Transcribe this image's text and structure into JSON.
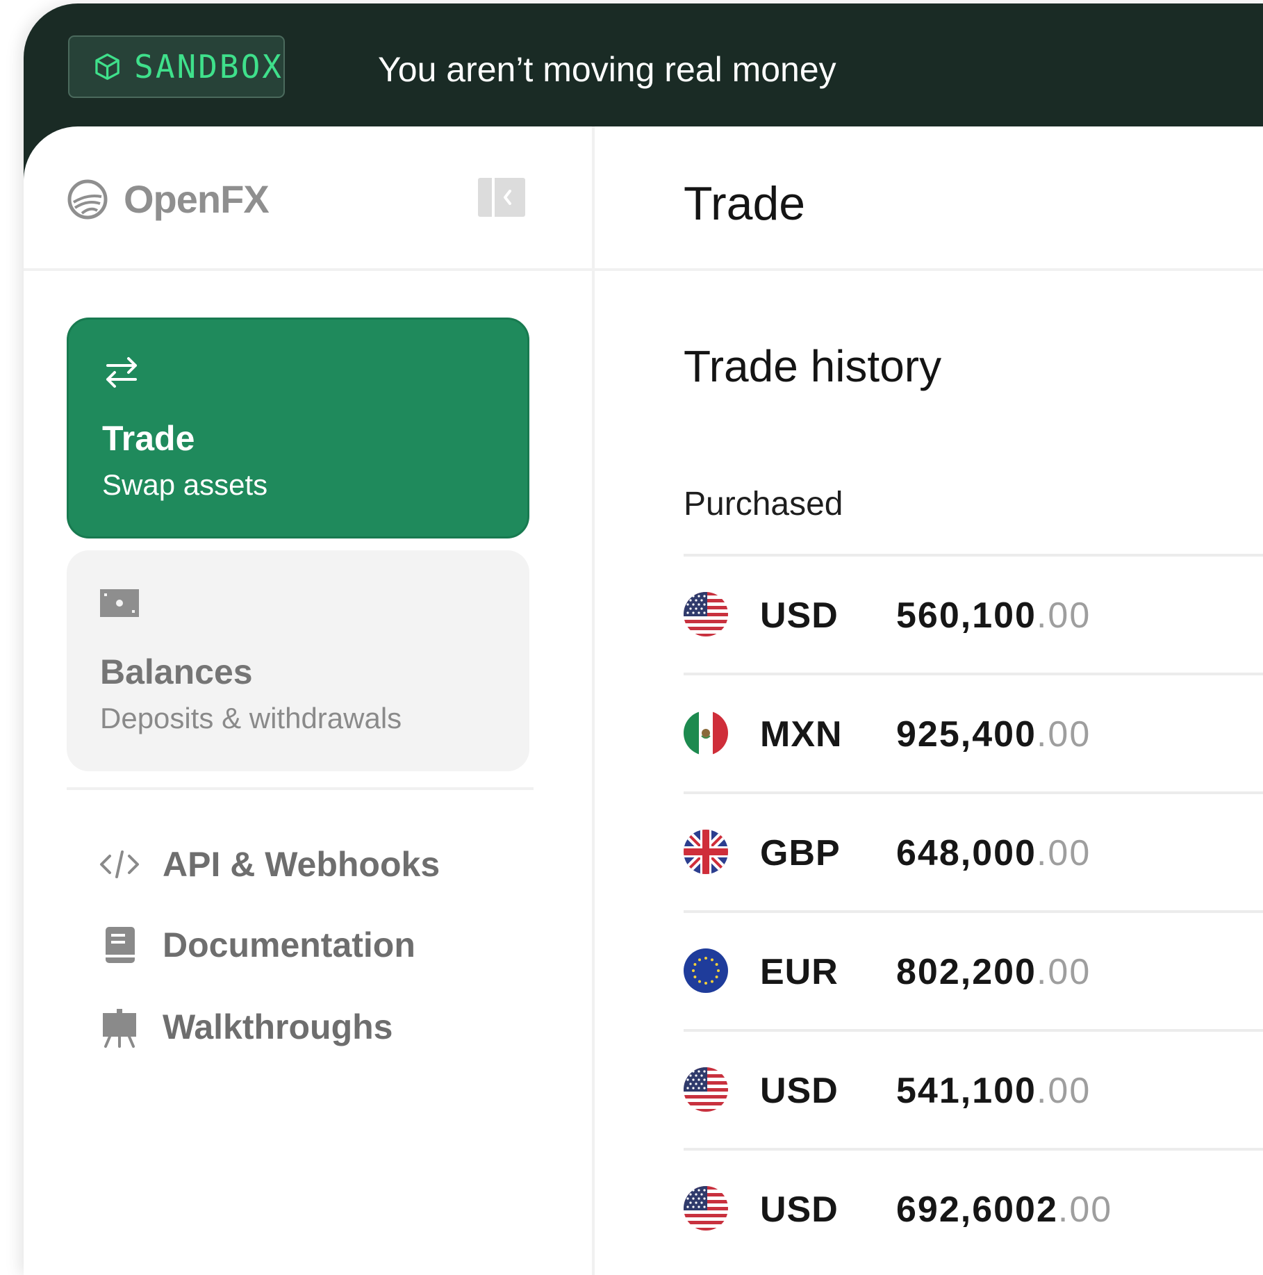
{
  "banner": {
    "badge_label": "SANDBOX",
    "note": "You aren’t moving real money"
  },
  "brand": {
    "name": "OpenFX"
  },
  "header": {
    "title": "Trade"
  },
  "sidebar": {
    "cards": [
      {
        "icon": "swap-arrows-icon",
        "title": "Trade",
        "subtitle": "Swap assets",
        "active": true
      },
      {
        "icon": "wallet-icon",
        "title": "Balances",
        "subtitle": "Deposits & withdrawals",
        "active": false
      }
    ],
    "links": [
      {
        "icon": "code-icon",
        "label": "API & Webhooks"
      },
      {
        "icon": "book-icon",
        "label": "Documentation"
      },
      {
        "icon": "easel-icon",
        "label": "Walkthroughs"
      }
    ]
  },
  "main": {
    "section_title": "Trade history",
    "column_header": "Purchased",
    "rows": [
      {
        "currency": "USD",
        "flag": "us-flag",
        "amount_whole": "560,100",
        "amount_decimal": ".00"
      },
      {
        "currency": "MXN",
        "flag": "mx-flag",
        "amount_whole": "925,400",
        "amount_decimal": ".00"
      },
      {
        "currency": "GBP",
        "flag": "gb-flag",
        "amount_whole": "648,000",
        "amount_decimal": ".00"
      },
      {
        "currency": "EUR",
        "flag": "eu-flag",
        "amount_whole": "802,200",
        "amount_decimal": ".00"
      },
      {
        "currency": "USD",
        "flag": "us-flag",
        "amount_whole": "541,100",
        "amount_decimal": ".00"
      },
      {
        "currency": "USD",
        "flag": "us-flag",
        "amount_whole": "692,6002",
        "amount_decimal": ".00"
      }
    ]
  },
  "colors": {
    "banner_bg": "#1a2b25",
    "badge_text": "#3fe08b",
    "active_card": "#1f8a5c",
    "idle_card": "#f3f3f3",
    "muted_text": "#6e6e6e",
    "decimal_text": "#9e9e9e"
  }
}
